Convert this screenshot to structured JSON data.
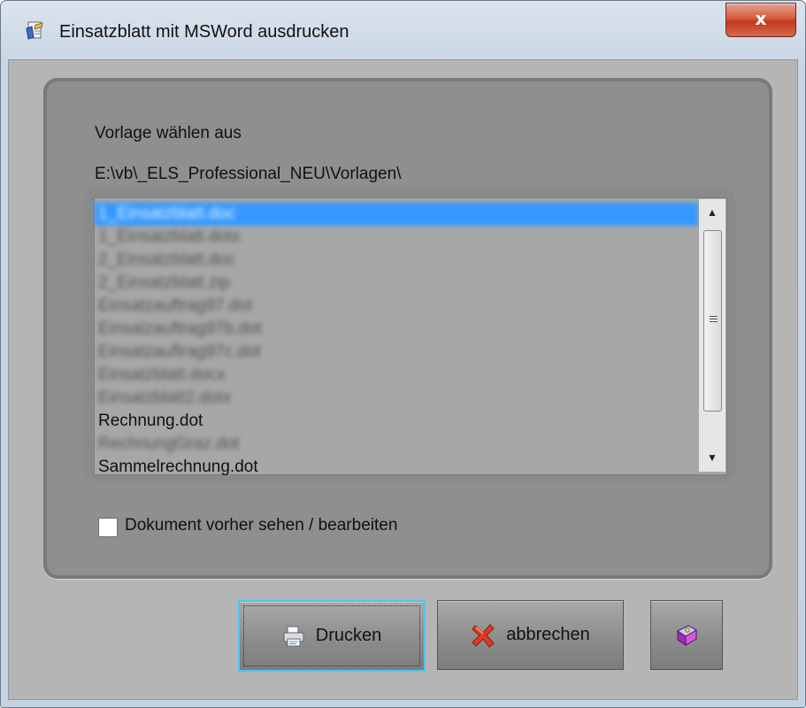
{
  "window": {
    "title": "Einsatzblatt mit MSWord ausdrucken",
    "close_symbol": "x",
    "app_icon": "word-document-icon"
  },
  "main": {
    "prompt_label": "Vorlage wählen aus",
    "path_label": "E:\\vb\\_ELS_Professional_NEU\\Vorlagen\\",
    "templates": [
      {
        "label": "1_Einsatzblatt.doc",
        "selected": true,
        "blurred": true
      },
      {
        "label": "1_Einsatzblatt.dotx",
        "selected": false,
        "blurred": true
      },
      {
        "label": "2_Einsatzblatt.doc",
        "selected": false,
        "blurred": true
      },
      {
        "label": "2_Einsatzblatt.zip",
        "selected": false,
        "blurred": true
      },
      {
        "label": "Einsatzauftrag97.dot",
        "selected": false,
        "blurred": true
      },
      {
        "label": "Einsatzauftrag97b.dot",
        "selected": false,
        "blurred": true
      },
      {
        "label": "Einsatzauftrag97c.dot",
        "selected": false,
        "blurred": true
      },
      {
        "label": "Einsatzblatt.docx",
        "selected": false,
        "blurred": true
      },
      {
        "label": "Einsatzblatt2.dotx",
        "selected": false,
        "blurred": true
      },
      {
        "label": "Rechnung.dot",
        "selected": false,
        "blurred": false
      },
      {
        "label": "RechnungGraz.dot",
        "selected": false,
        "blurred": true
      },
      {
        "label": "Sammelrechnung.dot",
        "selected": false,
        "blurred": false
      }
    ],
    "preview_checkbox_label": "Dokument vorher sehen / bearbeiten",
    "preview_checked": false
  },
  "buttons": {
    "print_label": "Drucken",
    "print_icon": "printer-icon",
    "cancel_label": "abbrechen",
    "cancel_icon": "red-x-icon",
    "help_icon": "help-book-icon"
  }
}
